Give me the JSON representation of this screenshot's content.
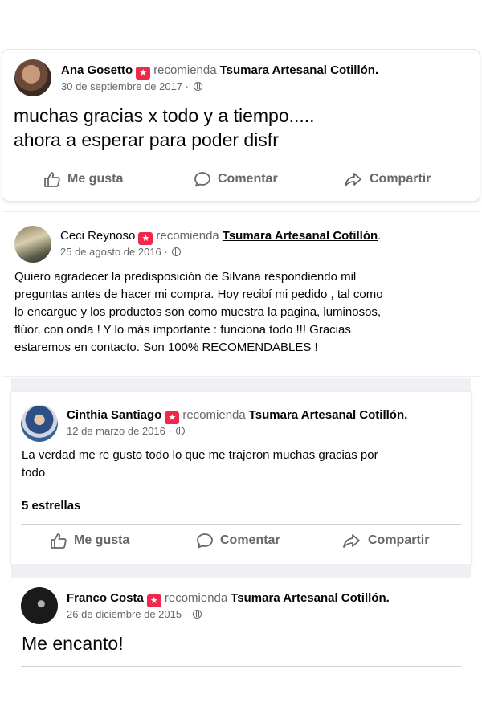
{
  "posts": [
    {
      "author": "Ana Gosetto",
      "verb": "recomienda",
      "page": "Tsumara Artesanal Cotillón.",
      "date": "30 de septiembre de 2017 ·",
      "text_lines": [
        "muchas gracias x todo y a tiempo.....",
        "ahora a esperar para poder disfr"
      ]
    },
    {
      "author": "Ceci Reynoso",
      "verb": "recomienda",
      "page": "Tsumara Artesanal Cotillón",
      "page_suffix": ".",
      "date": "25 de agosto de 2016 ·",
      "text_lines": [
        "Quiero agradecer la predisposición de Silvana respondiendo mil",
        "preguntas antes de hacer mi compra.  Hoy recibí mi pedido ,  tal como",
        "lo encargue y los productos son  como muestra la pagina, luminosos,",
        "flúor, con onda ! Y lo más importante : funciona todo !!! Gracias",
        "estaremos en contacto. Son 100% RECOMENDABLES !"
      ]
    },
    {
      "author": "Cinthia Santiago",
      "verb": "recomienda",
      "page": "Tsumara Artesanal Cotillón.",
      "date": "12 de marzo de 2016 ·",
      "text_lines": [
        "La verdad me re gusto todo lo que me trajeron muchas gracias por",
        "todo"
      ],
      "rating": "5 estrellas"
    },
    {
      "author": "Franco Costa",
      "verb": "recomienda",
      "page": "Tsumara Artesanal Cotillón.",
      "date": "26 de diciembre de 2015 ·",
      "text_lines": [
        "Me encanto!"
      ]
    }
  ],
  "actions": {
    "like": "Me gusta",
    "comment": "Comentar",
    "share": "Compartir"
  },
  "icons": {
    "recommend_badge": "recommend-icon",
    "privacy": "globe-icon",
    "like": "thumbs-up-icon",
    "comment": "comment-bubble-icon",
    "share": "share-arrow-icon"
  },
  "colors": {
    "badge": "#f02849",
    "secondary_text": "#65676b",
    "primary_text": "#050505"
  }
}
